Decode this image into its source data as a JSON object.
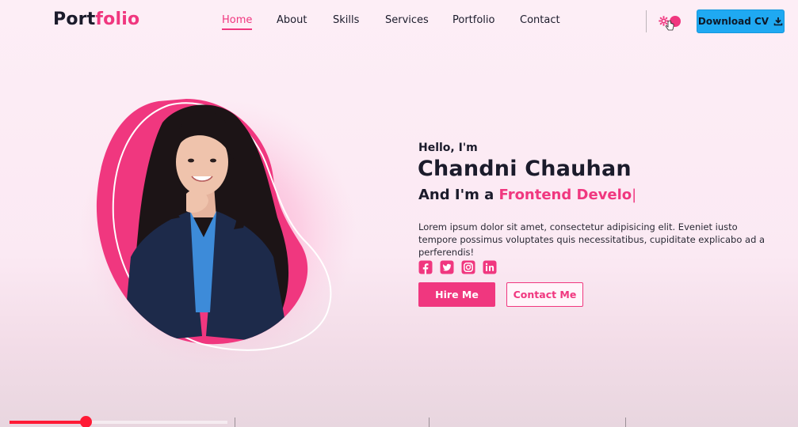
{
  "brand": {
    "part1": "Port",
    "part2": "folio"
  },
  "nav": {
    "items": [
      {
        "label": "Home",
        "active": true
      },
      {
        "label": "About"
      },
      {
        "label": "Skills"
      },
      {
        "label": "Services"
      },
      {
        "label": "Portfolio"
      },
      {
        "label": "Contact"
      }
    ]
  },
  "header": {
    "download_label": "Download CV",
    "theme_toggle_icon": "gear-icon"
  },
  "hero": {
    "greeting": "Hello, I'm",
    "name": "Chandni Chauhan",
    "role_prefix": "And I'm a ",
    "role_typed": "Frontend Develo",
    "caret": "|",
    "description": "Lorem ipsum dolor sit amet, consectetur adipisicing elit. Eveniet iusto tempore possimus voluptates quis necessitatibus, cupiditate explicabo ad a perferendis!",
    "socials": [
      "facebook-icon",
      "twitter-icon",
      "instagram-icon",
      "linkedin-icon"
    ],
    "hire_label": "Hire Me",
    "contact_label": "Contact Me"
  },
  "video": {
    "progress": 0.35
  },
  "colors": {
    "accent": "#f0377f",
    "download_bg": "#1fa9f2",
    "text": "#1b1b2b",
    "progress": "#ff1a35"
  }
}
